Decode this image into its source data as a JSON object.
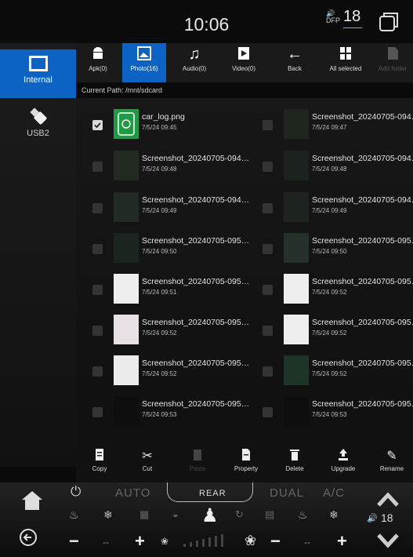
{
  "status": {
    "time": "10:06",
    "volume_icon": "speaker-icon",
    "volume_sub": "DFP",
    "volume_level": "18"
  },
  "storage": [
    {
      "label": "Internal",
      "icon": "sd-card-icon"
    },
    {
      "label": "USB2",
      "icon": "usb-icon"
    }
  ],
  "toolbar": [
    {
      "label": "Apk(0)",
      "icon": "android-icon"
    },
    {
      "label": "Photo(16)",
      "icon": "photo-icon"
    },
    {
      "label": "Audio(0)",
      "icon": "music-icon"
    },
    {
      "label": "Video(0)",
      "icon": "video-icon"
    },
    {
      "label": "Back",
      "icon": "back-arrow-icon"
    },
    {
      "label": "All selected",
      "icon": "select-all-icon"
    },
    {
      "label": "Add folder",
      "icon": "add-folder-icon"
    }
  ],
  "path": "Current Path: /mnt/sdcard",
  "files": [
    {
      "name": "car_log.png",
      "date": "7/5/24 09:45",
      "checked": true
    },
    {
      "name": "Screenshot_20240705-094…",
      "date": "7/5/24 09:47"
    },
    {
      "name": "Screenshot_20240705-094…",
      "date": "7/5/24 09:48"
    },
    {
      "name": "Screenshot_20240705-094…",
      "date": "7/5/24 09:48"
    },
    {
      "name": "Screenshot_20240705-094…",
      "date": "7/5/24 09:49"
    },
    {
      "name": "Screenshot_20240705-094…",
      "date": "7/5/24 09:49"
    },
    {
      "name": "Screenshot_20240705-095…",
      "date": "7/5/24 09:50"
    },
    {
      "name": "Screenshot_20240705-095…",
      "date": "7/5/24 09:50"
    },
    {
      "name": "Screenshot_20240705-095…",
      "date": "7/5/24 09:51"
    },
    {
      "name": "Screenshot_20240705-095…",
      "date": "7/5/24 09:52"
    },
    {
      "name": "Screenshot_20240705-095…",
      "date": "7/5/24 09:52"
    },
    {
      "name": "Screenshot_20240705-095…",
      "date": "7/5/24 09:52"
    },
    {
      "name": "Screenshot_20240705-095…",
      "date": "7/5/24 09:52"
    },
    {
      "name": "Screenshot_20240705-095…",
      "date": "7/5/24 09:52"
    },
    {
      "name": "Screenshot_20240705-095…",
      "date": "7/5/24 09:53"
    },
    {
      "name": "Screenshot_20240705-095…",
      "date": "7/5/24 09:53"
    }
  ],
  "actions": [
    {
      "label": "Copy",
      "icon": "copy-icon"
    },
    {
      "label": "Cut",
      "icon": "scissors-icon"
    },
    {
      "label": "Paste",
      "icon": "paste-icon"
    },
    {
      "label": "Property",
      "icon": "property-icon"
    },
    {
      "label": "Delete",
      "icon": "trash-icon"
    },
    {
      "label": "Upgrade",
      "icon": "upgrade-icon"
    },
    {
      "label": "Rename",
      "icon": "pencil-icon"
    }
  ],
  "climate": {
    "auto": "AUTO",
    "rear": "REAR",
    "dual": "DUAL",
    "ac": "A/C",
    "fan_level": "18",
    "minus": "−",
    "plus": "+",
    "dash": "--"
  },
  "colors": {
    "accent": "#0d63c4",
    "background": "#0a0a0a"
  }
}
